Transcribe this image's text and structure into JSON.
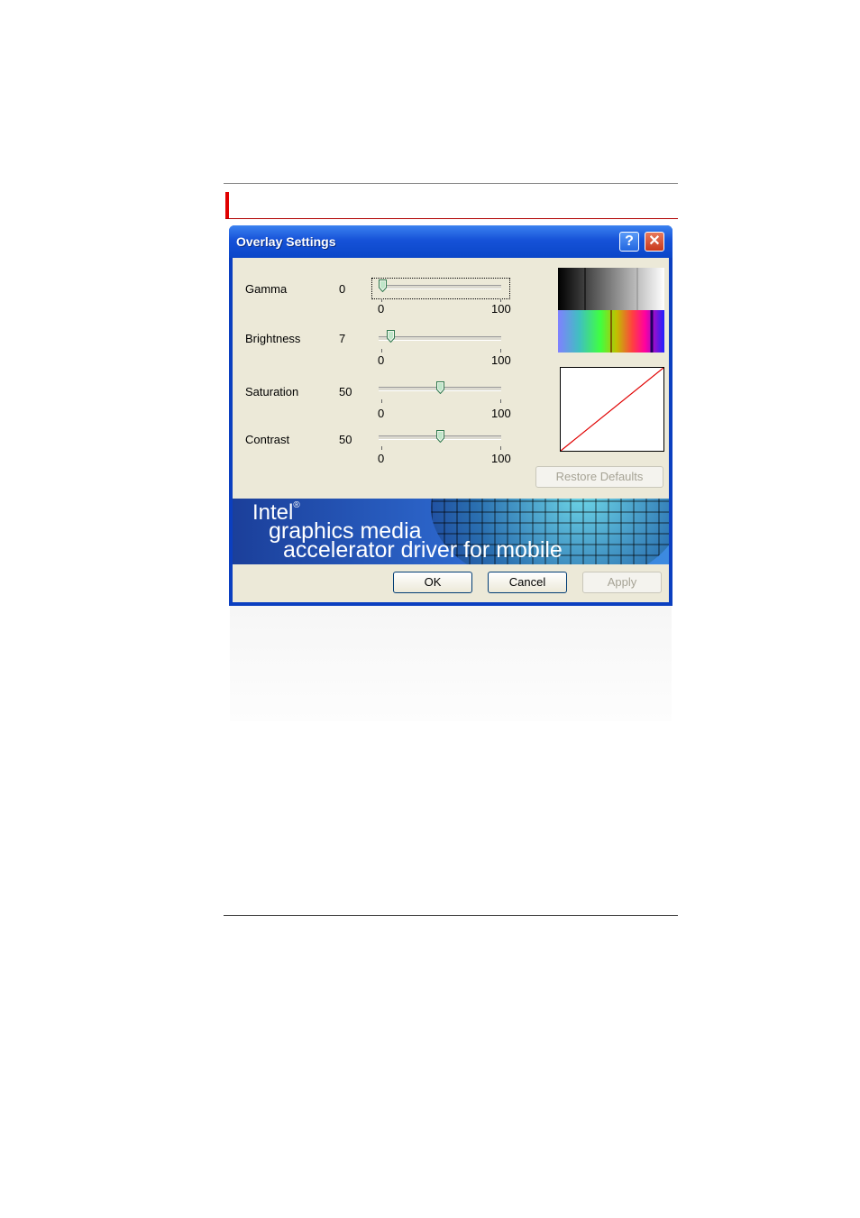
{
  "window": {
    "title": "Overlay Settings",
    "help_glyph": "?",
    "close_glyph": "✕"
  },
  "sliders": [
    {
      "label": "Gamma",
      "value": "0",
      "min_label": "0",
      "max_label": "100",
      "level": 0,
      "focused": true
    },
    {
      "label": "Brightness",
      "value": "7",
      "min_label": "0",
      "max_label": "100",
      "level": 7,
      "focused": false
    },
    {
      "label": "Saturation",
      "value": "50",
      "min_label": "0",
      "max_label": "100",
      "level": 50,
      "focused": false
    },
    {
      "label": "Contrast",
      "value": "50",
      "min_label": "0",
      "max_label": "100",
      "level": 50,
      "focused": false
    }
  ],
  "buttons": {
    "restore_defaults": "Restore Defaults",
    "ok": "OK",
    "cancel": "Cancel",
    "apply": "Apply"
  },
  "banner": {
    "brand": "Intel",
    "trademark": "®",
    "line2": "graphics media",
    "line3": "accelerator driver for mobile"
  },
  "colors": {
    "accent": "#e00000",
    "title_bar": "#0a46c8",
    "dialog_bg": "#ece9d8",
    "curve": "#e00000"
  },
  "icons": {
    "help": "help-icon",
    "close": "close-icon"
  }
}
